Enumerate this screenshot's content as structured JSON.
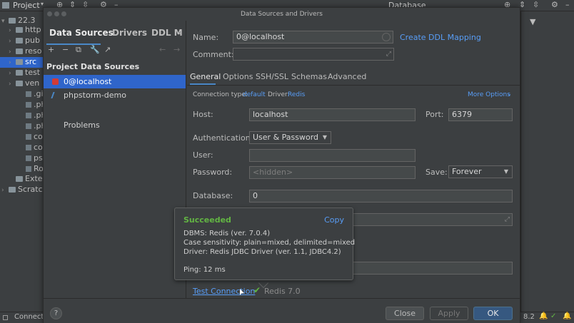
{
  "ide": {
    "project_label": "Project",
    "database_label": "Database",
    "tree": [
      {
        "label": "22.3",
        "kind": "folder",
        "arrow": "▾"
      },
      {
        "label": "http",
        "kind": "folder",
        "arrow": "›"
      },
      {
        "label": "pub",
        "kind": "folder",
        "arrow": "›"
      },
      {
        "label": "reso",
        "kind": "folder",
        "arrow": "›"
      },
      {
        "label": "src",
        "kind": "folder",
        "arrow": "›",
        "selected": true
      },
      {
        "label": "test",
        "kind": "folder",
        "arrow": "›"
      },
      {
        "label": "ven",
        "kind": "folder",
        "arrow": "›"
      },
      {
        "label": ".giti",
        "kind": "file",
        "arrow": ""
      },
      {
        "label": ".php",
        "kind": "file",
        "arrow": ""
      },
      {
        "label": ".php",
        "kind": "file",
        "arrow": ""
      },
      {
        "label": ".php",
        "kind": "file",
        "arrow": ""
      },
      {
        "label": "com",
        "kind": "file",
        "arrow": ""
      },
      {
        "label": "com",
        "kind": "file",
        "arrow": ""
      },
      {
        "label": "psa",
        "kind": "file",
        "arrow": ""
      },
      {
        "label": "Rob",
        "kind": "file",
        "arrow": ""
      },
      {
        "label": "Extern",
        "kind": "folder",
        "arrow": ""
      },
      {
        "label": "Scratc",
        "kind": "folder",
        "arrow": "›"
      }
    ],
    "status_text": "Connecte",
    "status_right": "8.2"
  },
  "dialog": {
    "title": "Data Sources and Drivers",
    "left_tabs": [
      "Data Sources",
      "Drivers",
      "DDL M"
    ],
    "project_ds_header": "Project Data Sources",
    "data_sources": [
      {
        "label": "0@localhost",
        "selected": true,
        "color": "#d33b35"
      },
      {
        "label": "phpstorm-demo",
        "selected": false,
        "color": "#4a88c7"
      }
    ],
    "problems_label": "Problems",
    "name_label": "Name:",
    "name_value": "0@localhost",
    "create_ddl_link": "Create DDL Mapping",
    "comment_label": "Comment:",
    "tabs": [
      "General",
      "Options",
      "SSH/SSL",
      "Schemas",
      "Advanced"
    ],
    "conn_type_label": "Connection type:",
    "conn_type_value": "default",
    "driver_label": "Driver:",
    "driver_value": "Redis",
    "more_options": "More Options",
    "host_label": "Host:",
    "host_value": "localhost",
    "port_label": "Port:",
    "port_value": "6379",
    "auth_label": "Authentication:",
    "auth_value": "User & Password",
    "user_label": "User:",
    "password_label": "Password:",
    "password_placeholder": "<hidden>",
    "save_label": "Save:",
    "save_value": "Forever",
    "database_label": "Database:",
    "database_value": "0",
    "test_connection": "Test Connection",
    "test_result": "Redis 7.0",
    "buttons": {
      "close": "Close",
      "apply": "Apply",
      "ok": "OK"
    }
  },
  "popup": {
    "title": "Succeeded",
    "copy": "Copy",
    "lines": [
      "DBMS: Redis (ver. 7.0.4)",
      "Case sensitivity: plain=mixed, delimited=mixed",
      "Driver: Redis JDBC Driver (ver. 1.1, JDBC4.2)"
    ],
    "ping": "Ping: 12 ms"
  }
}
